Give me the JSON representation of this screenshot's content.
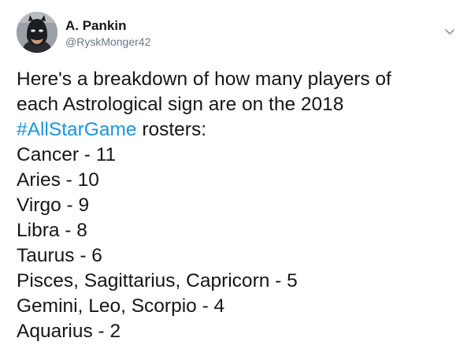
{
  "author": {
    "name": "A. Pankin",
    "handle": "@RyskMonger42"
  },
  "icons": {
    "avatar": "masked-hero-avatar",
    "menu": "chevron-down-icon"
  },
  "colors": {
    "text": "#14171a",
    "secondary": "#657786",
    "hashtag": "#1b95e0"
  },
  "tweet": {
    "intro_line1": "Here's a breakdown of how many players of",
    "intro_line2": "each Astrological sign are on the 2018",
    "hashtag": "#AllStarGame",
    "intro_line3_rest": " rosters:",
    "signs": [
      "Cancer - 11",
      "Aries - 10",
      "Virgo - 9",
      "Libra - 8",
      "Taurus - 6",
      "Pisces, Sagittarius, Capricorn - 5",
      "Gemini, Leo, Scorpio - 4",
      "Aquarius - 2"
    ]
  }
}
